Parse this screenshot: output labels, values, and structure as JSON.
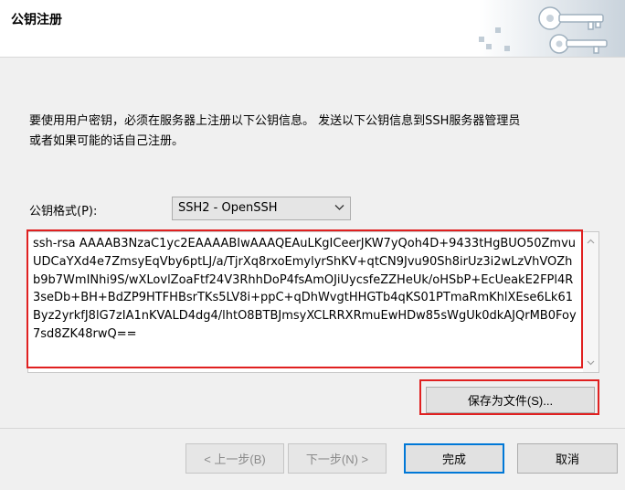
{
  "window": {
    "title": "公钥注册"
  },
  "description": {
    "line1": "要使用用户密钥，必须在服务器上注册以下公钥信息。 发送以下公钥信息到SSH服务器管理员",
    "line2": "或者如果可能的话自己注册。"
  },
  "format": {
    "label": "公钥格式(P):",
    "selected": "SSH2 - OpenSSH"
  },
  "public_key": "ssh-rsa AAAAB3NzaC1yc2EAAAABIwAAAQEAuLKgICeerJKW7yQoh4D+9433tHgBUO50ZmvuUDCaYXd4e7ZmsyEqVby6ptLJ/a/TjrXq8rxoEmylyrShKV+qtCN9Jvu90Sh8irUz3i2wLzVhVOZhb9b7WmINhi9S/wXLovlZoaFtf24V3RhhDoP4fsAmOJiUycsfeZZHeUk/oHSbP+EcUeakE2FPl4R3seDb+BH+BdZP9HTFHBsrTKs5LV8i+ppC+qDhWvgtHHGTb4qKS01PTmaRmKhlXEse6Lk61Byz2yrkfJ8lG7zIA1nKVALD4dg4/lhtO8BTBJmsyXCLRRXRmuEwHDw85sWgUk0dkAJQrMB0Foy7sd8ZK48rwQ==",
  "buttons": {
    "save": "保存为文件(S)...",
    "back": "< 上一步(B)",
    "next": "下一步(N) >",
    "finish": "完成",
    "cancel": "取消"
  },
  "colors": {
    "highlight": "#e02020",
    "default_button_border": "#0078d7"
  },
  "icons": {
    "header_art": "keys-icon",
    "dropdown": "chevron-down-icon"
  }
}
